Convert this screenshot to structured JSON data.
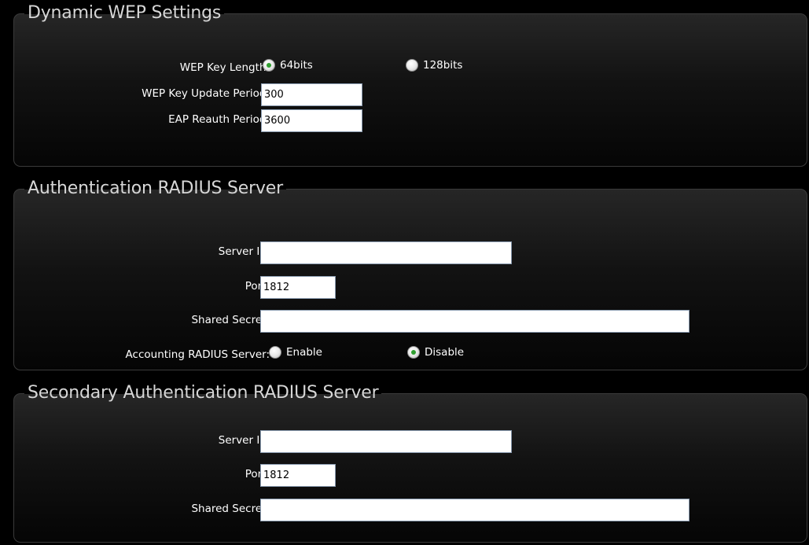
{
  "dynamic_wep": {
    "title": "Dynamic WEP Settings",
    "key_length_label": "WEP Key Length:",
    "key_length_options": [
      "64bits",
      "128bits"
    ],
    "key_length_selected": "64bits",
    "update_period_label": "WEP Key Update Period:",
    "update_period_value": "300",
    "reauth_period_label": "EAP Reauth Period:",
    "reauth_period_value": "3600"
  },
  "auth_radius": {
    "title": "Authentication RADIUS Server",
    "server_ip_label": "Server IP:",
    "server_ip_value": "",
    "port_label": "Port:",
    "port_value": "1812",
    "shared_secret_label": "Shared Secret:",
    "shared_secret_value": "",
    "accounting_label": "Accounting RADIUS Server:",
    "accounting_options": [
      "Enable",
      "Disable"
    ],
    "accounting_selected": "Disable"
  },
  "secondary_radius": {
    "title": "Secondary Authentication RADIUS Server",
    "server_ip_label": "Server IP:",
    "server_ip_value": "",
    "port_label": "Port:",
    "port_value": "1812",
    "shared_secret_label": "Shared Secret:",
    "shared_secret_value": ""
  },
  "colors": {
    "background": "#000000",
    "label_text": "#ffffff",
    "legend_text": "#d6d6d6",
    "radio_checked": "#2f9e2f"
  }
}
